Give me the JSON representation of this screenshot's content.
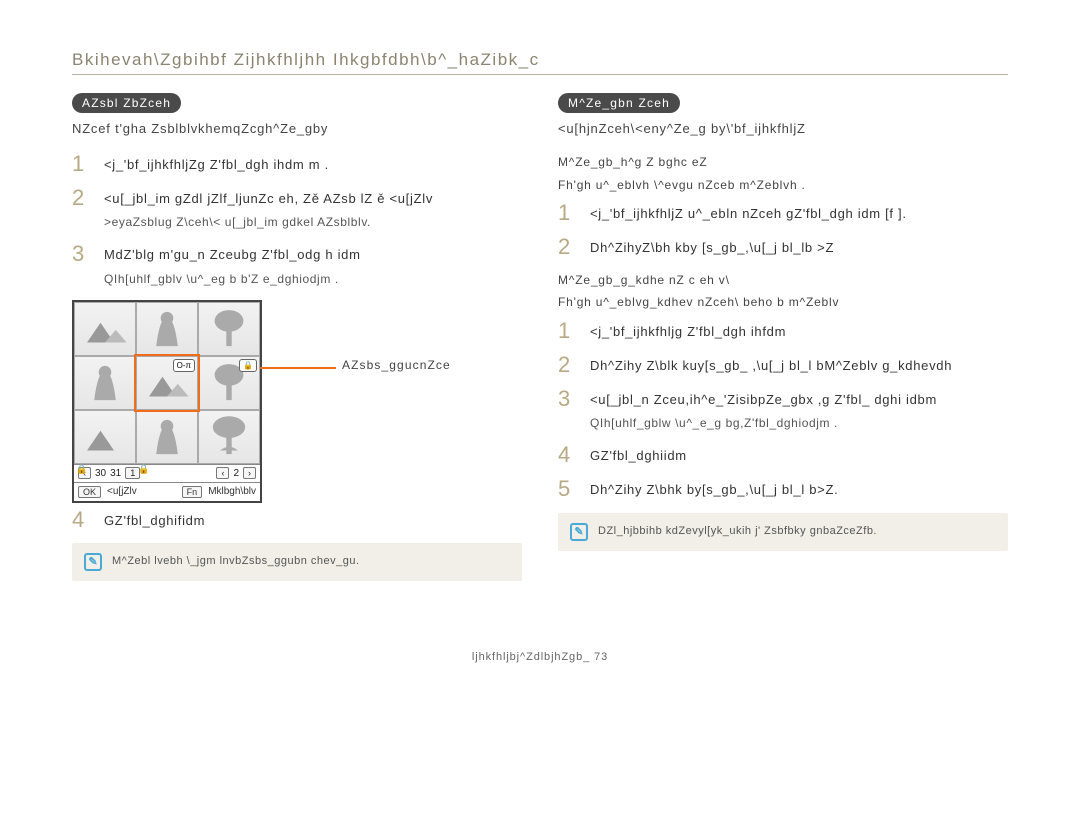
{
  "page_title": "Bkihevah\\Zgbihbf Zijhkfhljhh Ihkgbfdbh\\b^_haZibk_c",
  "footer": "ljhkfhljbj^ZdlbjhZgb_  73",
  "left": {
    "tag": "AZsbl ZbZceh",
    "lead": "NZcef t'gha ZsblblvkhemqZcgh^Ze_gby",
    "steps": [
      {
        "n": "1",
        "text": "<j_'bf_ijhkfhljZg Z'fbl_dgh ihdm m ."
      },
      {
        "n": "2",
        "text": "<u[_jbl_im gZdl jZlf_ljunZc eh, Zě AZsb lZ ě <u[jZlv",
        "sub": ">eyaZsblug Z\\ceh\\< u[_jbl_im gdkel AZsblblv."
      },
      {
        "n": "3",
        "text": "MdZ'blg m'gu_n Zceubg Z'fbl_odg h idm",
        "sub": "QIh[uhlf_gblv \\u^_eg b b'Z e_dghiodjm ."
      },
      {
        "n": "4",
        "text": "GZ'fbl_dghifidm"
      }
    ],
    "callout": "AZsbs_ggucnZce",
    "screen": {
      "bottom1": {
        "arrow_l": "‹",
        "v1": "30",
        "v2": "31",
        "page": "1",
        "arrow_l2": "‹",
        "v3": "2",
        "arrow_r": "›"
      },
      "bottom2": {
        "k1": "OK",
        "l1": "<u[jZlv",
        "k2": "Fn",
        "l2": "Mklbgh\\blv"
      }
    },
    "note": "M^Zebl lvebh \\_jgm lnvbZsbs_ggubn chev_gu."
  },
  "right": {
    "tag": "M^Ze_gbn Zceh",
    "lead": "<u[hjnZceh\\<eny^Ze_g by\\'bf_ijhkfhljZ",
    "head1_a": "M^Ze_gb_h^g Z bghc eZ",
    "head1_b": "Fh'gh u^_eblvh \\^evgu nZceb m^Zeblvh .",
    "steps1": [
      {
        "n": "1",
        "text": "<j_'bf_ijhkfhljZ u^_ebln nZceh gZ'fbl_dgh idm [f   ]."
      },
      {
        "n": "2",
        "text": "Dh^ZihyZ\\bh kby [s_gb_,\\u[_j bl_lb >Z"
      }
    ],
    "head2_a": "M^Ze_gb_g_kdhe nZ c eh v\\",
    "head2_b": "Fh'gh u^_eblvg_kdhev nZceh\\ beho b m^Zeblv",
    "steps2": [
      {
        "n": "1",
        "text": "<j_'bf_ijhkfhljg Z'fbl_dgh ihfdm"
      },
      {
        "n": "2",
        "text": "Dh^Zihy Z\\blk kuy[s_gb_ ,\\u[_j bl_l bM^Zeblv g_kdhevdh"
      },
      {
        "n": "3",
        "text": "<u[_jbl_n Zceu,ih^e_'ZisibpZe_gbx ,g Z'fbl_ dghi idbm",
        "sub": "QIh[uhlf_gblw \\u^_e_g bg,Z'fbl_dghiodjm ."
      },
      {
        "n": "4",
        "text": "GZ'fbl_dghiidm"
      },
      {
        "n": "5",
        "text": "Dh^Zihy Z\\bhk by[s_gb_,\\u[_j bl_l b>Z."
      }
    ],
    "note": "DZl_hjbbihb kdZevyl[yk_ukih j' Zsbfbky gnbaZceZfb."
  }
}
